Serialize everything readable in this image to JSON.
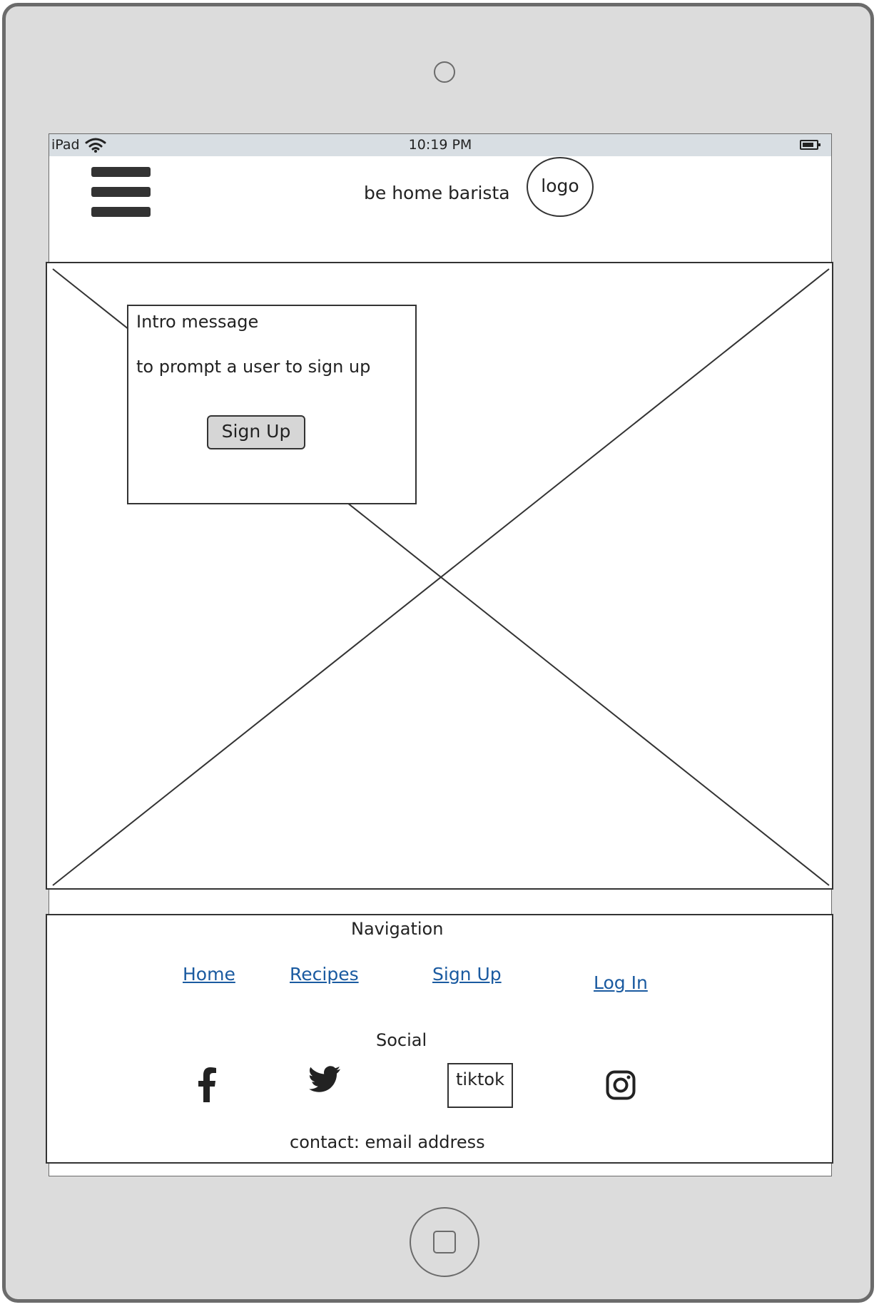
{
  "status_bar": {
    "device": "iPad",
    "time": "10:19 PM"
  },
  "header": {
    "site_name": "be home barista",
    "logo_label": "logo"
  },
  "hero": {
    "intro_title": "Intro message",
    "intro_text": "to prompt a user to sign up",
    "signup_button": "Sign Up"
  },
  "footer": {
    "navigation_title": "Navigation",
    "nav_links": [
      "Home",
      "Recipes",
      "Sign Up",
      "Log In"
    ],
    "social_title": "Social",
    "social": {
      "icons": [
        "facebook-icon",
        "twitter-icon",
        "tiktok",
        "instagram-icon"
      ],
      "tiktok_label": "tiktok"
    },
    "contact": "contact: email address"
  },
  "colors": {
    "device_frame": "#dcdcdc",
    "status_bar": "#d8dee3",
    "link": "#1a5aa0",
    "button": "#d6d6d6"
  }
}
